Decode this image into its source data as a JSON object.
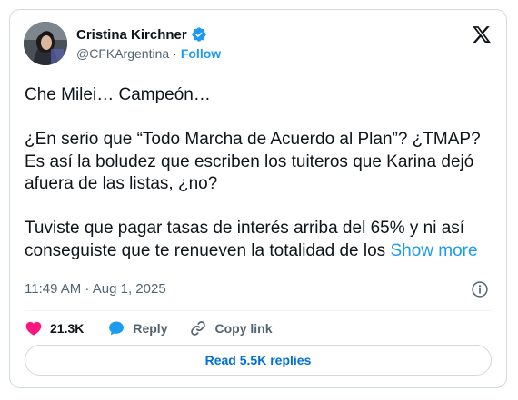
{
  "author": {
    "display_name": "Cristina Kirchner",
    "handle": "@CFKArgentina",
    "separator": "·",
    "follow_label": "Follow",
    "verified_icon": "verified-badge-icon",
    "avatar_icon": "profile-avatar"
  },
  "brand": {
    "logo_icon": "x-logo-icon"
  },
  "tweet": {
    "line1": "Che Milei… Campeón…",
    "para2": "¿En serio que “Todo Marcha de Acuerdo al Plan”? ¿TMAP? Es así la boludez que escriben los tuiteros que Karina dejó afuera de las listas, ¿no?",
    "para3": "Tuviste que pagar tasas de interés arriba del 65% y ni así conseguiste que te renueven la totalidad de los",
    "show_more": "Show more"
  },
  "meta": {
    "timestamp": "11:49 AM · Aug 1, 2025",
    "info_icon": "info-icon"
  },
  "actions": {
    "like_count": "21.3K",
    "reply_label": "Reply",
    "copy_label": "Copy link",
    "like_icon": "heart-icon",
    "reply_icon": "speech-bubble-icon",
    "copy_icon": "link-icon"
  },
  "replies": {
    "label": "Read 5.5K replies"
  },
  "colors": {
    "accent": "#1d9bf0",
    "like": "#f91880",
    "text": "#0f1419",
    "muted": "#536471",
    "border": "#cfd9de"
  }
}
